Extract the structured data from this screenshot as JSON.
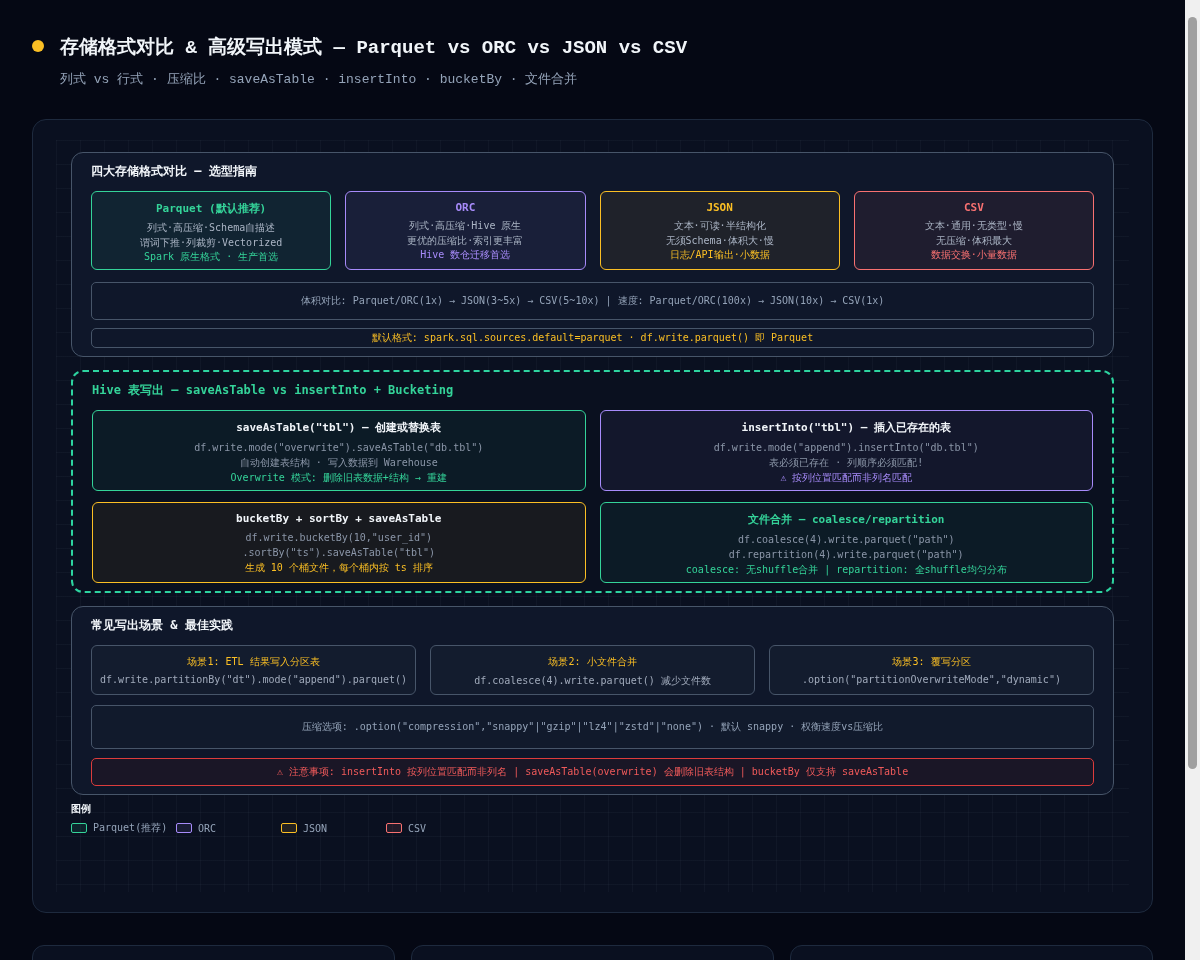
{
  "header": {
    "title": "存储格式对比 & 高级写出模式 — Parquet vs ORC vs JSON vs CSV",
    "subtitle": "列式 vs 行式 · 压缩比 · saveAsTable · insertInto · bucketBy · 文件合并"
  },
  "formats_panel": {
    "title": "四大存储格式对比 — 选型指南",
    "formats": [
      {
        "name": "Parquet (默认推荐)",
        "lines": [
          "列式·高压缩·Schema自描述",
          "谓词下推·列裁剪·Vectorized"
        ],
        "note": "Spark 原生格式 · 生产首选",
        "color": "#34d399"
      },
      {
        "name": "ORC",
        "lines": [
          "列式·高压缩·Hive 原生",
          "更优的压缩比·索引更丰富"
        ],
        "note": "Hive 数仓迁移首选",
        "color": "#a78bfa"
      },
      {
        "name": "JSON",
        "lines": [
          "文本·可读·半结构化",
          "无须Schema·体积大·慢"
        ],
        "note": "日志/API输出·小数据",
        "color": "#fbbf24"
      },
      {
        "name": "CSV",
        "lines": [
          "文本·通用·无类型·慢",
          "无压缩·体积最大"
        ],
        "note": "数据交换·小量数据",
        "color": "#f87171"
      }
    ],
    "size_compare": "体积对比: Parquet/ORC(1x) → JSON(3~5x) → CSV(5~10x) | 速度: Parquet/ORC(100x) → JSON(10x) → CSV(1x)",
    "default_note": "默认格式: spark.sql.sources.default=parquet · df.write.parquet() 即 Parquet"
  },
  "hive_panel": {
    "title": "Hive 表写出 — saveAsTable vs insertInto + Bucketing",
    "cards": [
      {
        "title": "saveAsTable(\"tbl\") — 创建或替换表",
        "accent_title": false,
        "lines": [
          "df.write.mode(\"overwrite\").saveAsTable(\"db.tbl\")",
          "自动创建表结构 · 写入数据到 Warehouse",
          "Overwrite 模式: 删除旧表数据+结构 → 重建"
        ],
        "color": "#34d399"
      },
      {
        "title": "insertInto(\"tbl\") — 插入已存在的表",
        "accent_title": false,
        "lines": [
          "df.write.mode(\"append\").insertInto(\"db.tbl\")",
          "表必须已存在 · 列顺序必须匹配!",
          "⚠ 按列位置匹配而非列名匹配"
        ],
        "color": "#a78bfa"
      },
      {
        "title": "bucketBy + sortBy + saveAsTable",
        "accent_title": false,
        "lines": [
          "df.write.bucketBy(10,\"user_id\")",
          ".sortBy(\"ts\").saveAsTable(\"tbl\")",
          "生成 10 个桶文件，每个桶内按 ts 排序"
        ],
        "color": "#fbbf24"
      },
      {
        "title": "文件合并 — coalesce/repartition",
        "accent_title": true,
        "lines": [
          "df.coalesce(4).write.parquet(\"path\")",
          "df.repartition(4).write.parquet(\"path\")",
          "coalesce: 无shuffle合并 | repartition: 全shuffle均匀分布"
        ],
        "color": "#34d399"
      }
    ]
  },
  "scenarios_panel": {
    "title": "常见写出场景 & 最佳实践",
    "scenarios": [
      {
        "title": "场景1: ETL 结果写入分区表",
        "code": "df.write.partitionBy(\"dt\").mode(\"append\").parquet()"
      },
      {
        "title": "场景2: 小文件合并",
        "code": "df.coalesce(4).write.parquet() 减少文件数"
      },
      {
        "title": "场景3: 覆写分区",
        "code": ".option(\"partitionOverwriteMode\",\"dynamic\")"
      }
    ],
    "compression": "压缩选项: .option(\"compression\",\"snappy\"|\"gzip\"|\"lz4\"|\"zstd\"|\"none\") · 默认 snappy · 权衡速度vs压缩比",
    "warning": "⚠ 注意事项: insertInto 按列位置匹配而非列名 | saveAsTable(overwrite) 会删除旧表结构 | bucketBy 仅支持 saveAsTable"
  },
  "legend": {
    "title": "图例",
    "items": [
      {
        "label": "Parquet(推荐)",
        "color": "#34d399"
      },
      {
        "label": "ORC",
        "color": "#a78bfa"
      },
      {
        "label": "JSON",
        "color": "#fbbf24"
      },
      {
        "label": "CSV",
        "color": "#f87171"
      }
    ]
  }
}
